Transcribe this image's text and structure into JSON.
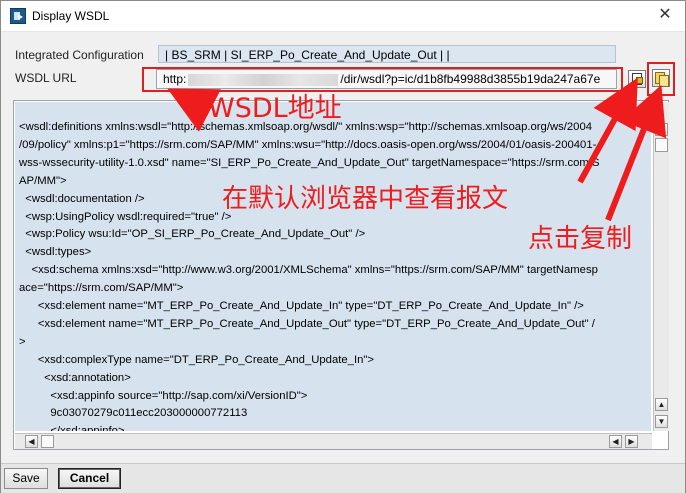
{
  "window": {
    "title": "Display WSDL",
    "close_glyph": "✕"
  },
  "form": {
    "integrated_configuration_label": "Integrated Configuration",
    "integrated_configuration_value": "| BS_SRM | SI_ERP_Po_Create_And_Update_Out |  |",
    "wsdl_url_label": "WSDL URL",
    "wsdl_url_prefix": "http:",
    "wsdl_url_suffix": "/dir/wsdl?p=ic/d1b8fb49988d3855b19da247a67e"
  },
  "toolbar_icons": {
    "open_in_browser": "browser-open-icon",
    "copy_url": "copy-icon"
  },
  "xml_lines": [
    "<wsdl:definitions xmlns:wsdl=\"http://schemas.xmlsoap.org/wsdl/\" xmlns:wsp=\"http://schemas.xmlsoap.org/ws/2004",
    "/09/policy\" xmlns:p1=\"https://srm.com/SAP/MM\" xmlns:wsu=\"http://docs.oasis-open.org/wss/2004/01/oasis-200401-",
    "wss-wssecurity-utility-1.0.xsd\" name=\"SI_ERP_Po_Create_And_Update_Out\" targetNamespace=\"https://srm.com/S",
    "AP/MM\">",
    "  <wsdl:documentation />",
    "  <wsp:UsingPolicy wsdl:required=\"true\" />",
    "  <wsp:Policy wsu:Id=\"OP_SI_ERP_Po_Create_And_Update_Out\" />",
    "  <wsdl:types>",
    "    <xsd:schema xmlns:xsd=\"http://www.w3.org/2001/XMLSchema\" xmlns=\"https://srm.com/SAP/MM\" targetNamesp",
    "ace=\"https://srm.com/SAP/MM\">",
    "      <xsd:element name=\"MT_ERP_Po_Create_And_Update_In\" type=\"DT_ERP_Po_Create_And_Update_In\" />",
    "      <xsd:element name=\"MT_ERP_Po_Create_And_Update_Out\" type=\"DT_ERP_Po_Create_And_Update_Out\" /",
    ">",
    "      <xsd:complexType name=\"DT_ERP_Po_Create_And_Update_In\">",
    "        <xsd:annotation>",
    "          <xsd:appinfo source=\"http://sap.com/xi/VersionID\">",
    "          9c03070279c011ecc203000000772113",
    "          </xsd:appinfo>"
  ],
  "annotations": {
    "wsdl_address": "WSDL地址",
    "view_in_browser": "在默认浏览器中查看报文",
    "click_to_copy": "点击复制",
    "color": "#ee1c1c"
  },
  "footer": {
    "save_label": "Save",
    "cancel_label": "Cancel"
  }
}
